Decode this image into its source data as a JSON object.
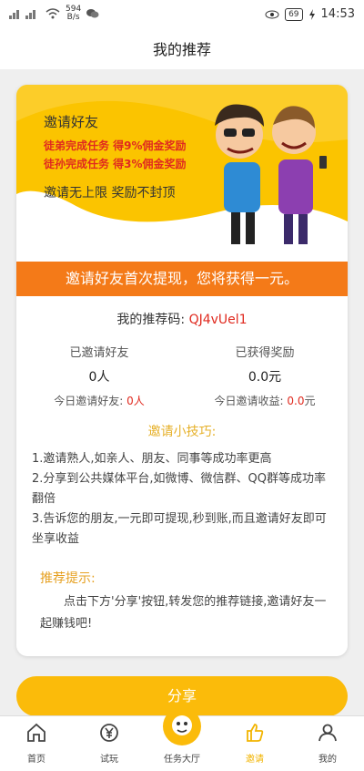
{
  "status_bar": {
    "network_speed": "594",
    "network_unit": "B/s",
    "battery": "69",
    "time": "14:53"
  },
  "header": {
    "title": "我的推荐"
  },
  "banner": {
    "title": "邀请好友",
    "line1": "徒弟完成任务 得9%佣金奖励",
    "line2": "徒孙完成任务 得3%佣金奖励",
    "footer": "邀请无上限 奖励不封顶"
  },
  "strip": {
    "text": "邀请好友首次提现，您将获得一元。"
  },
  "referral": {
    "label": "我的推荐码: ",
    "code": "QJ4vUel1"
  },
  "stats": {
    "invited": {
      "label": "已邀请好友",
      "value": "0人",
      "today_label": "今日邀请好友: ",
      "today_value": "0人"
    },
    "reward": {
      "label": "已获得奖励",
      "value": "0.0元",
      "today_label": "今日邀请收益: ",
      "today_value": "0.0",
      "today_unit": "元"
    }
  },
  "tips": {
    "title": "邀请小技巧:",
    "items": [
      "1.邀请熟人,如亲人、朋友、同事等成功率更高",
      "2.分享到公共媒体平台,如微博、微信群、QQ群等成功率翻倍",
      "3.告诉您的朋友,一元即可提现,秒到账,而且邀请好友即可坐享收益"
    ]
  },
  "hint": {
    "title": "推荐提示:",
    "text": "点击下方'分享'按钮,转发您的推荐链接,邀请好友一起赚钱吧!"
  },
  "share_button": {
    "label": "分享"
  },
  "tabbar": {
    "items": [
      {
        "label": "首页",
        "icon": "home-icon"
      },
      {
        "label": "试玩",
        "icon": "yen-cycle-icon"
      },
      {
        "label": "任务大厅",
        "icon": "mascot-icon"
      },
      {
        "label": "邀请",
        "icon": "thumbs-up-icon"
      },
      {
        "label": "我的",
        "icon": "user-icon"
      }
    ],
    "active_index": 3,
    "active_color": "#f2b400"
  },
  "colors": {
    "accent_yellow": "#fbbb0a",
    "strip_orange": "#f47a18",
    "highlight_red": "#e02a1f"
  }
}
